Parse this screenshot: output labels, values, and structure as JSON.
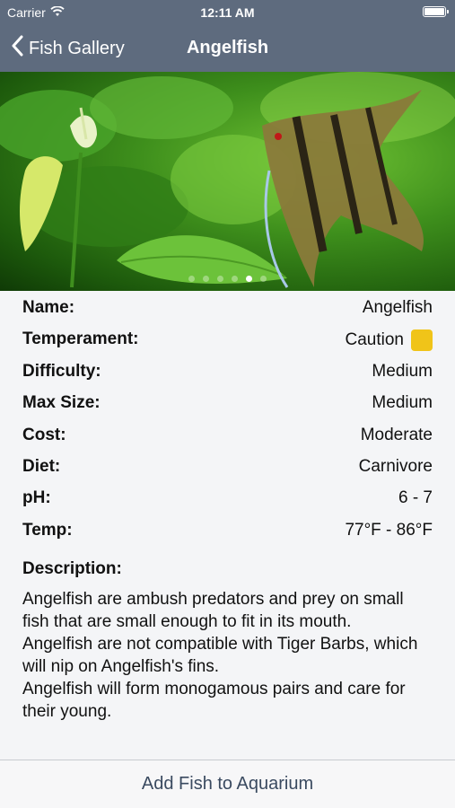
{
  "status": {
    "carrier": "Carrier",
    "time": "12:11 AM"
  },
  "nav": {
    "back_label": "Fish Gallery",
    "title": "Angelfish"
  },
  "gallery": {
    "page_count": 6,
    "active_index": 4
  },
  "details": [
    {
      "key": "Name:",
      "value": "Angelfish"
    },
    {
      "key": "Temperament:",
      "value": "Caution",
      "swatch_color": "#f0c419"
    },
    {
      "key": "Difficulty:",
      "value": "Medium"
    },
    {
      "key": "Max Size:",
      "value": "Medium"
    },
    {
      "key": "Cost:",
      "value": "Moderate"
    },
    {
      "key": "Diet:",
      "value": "Carnivore"
    },
    {
      "key": "pH:",
      "value": "6 - 7"
    },
    {
      "key": "Temp:",
      "value": "77°F - 86°F"
    }
  ],
  "description": {
    "heading": "Description:",
    "paragraphs": [
      "Angelfish are ambush predators and prey on small fish that are small enough to fit in its mouth.",
      "Angelfish are not compatible with Tiger Barbs, which will nip on Angelfish's fins.",
      "Angelfish will form monogamous pairs and care for their young."
    ]
  },
  "toolbar": {
    "add_label": "Add Fish to Aquarium"
  }
}
